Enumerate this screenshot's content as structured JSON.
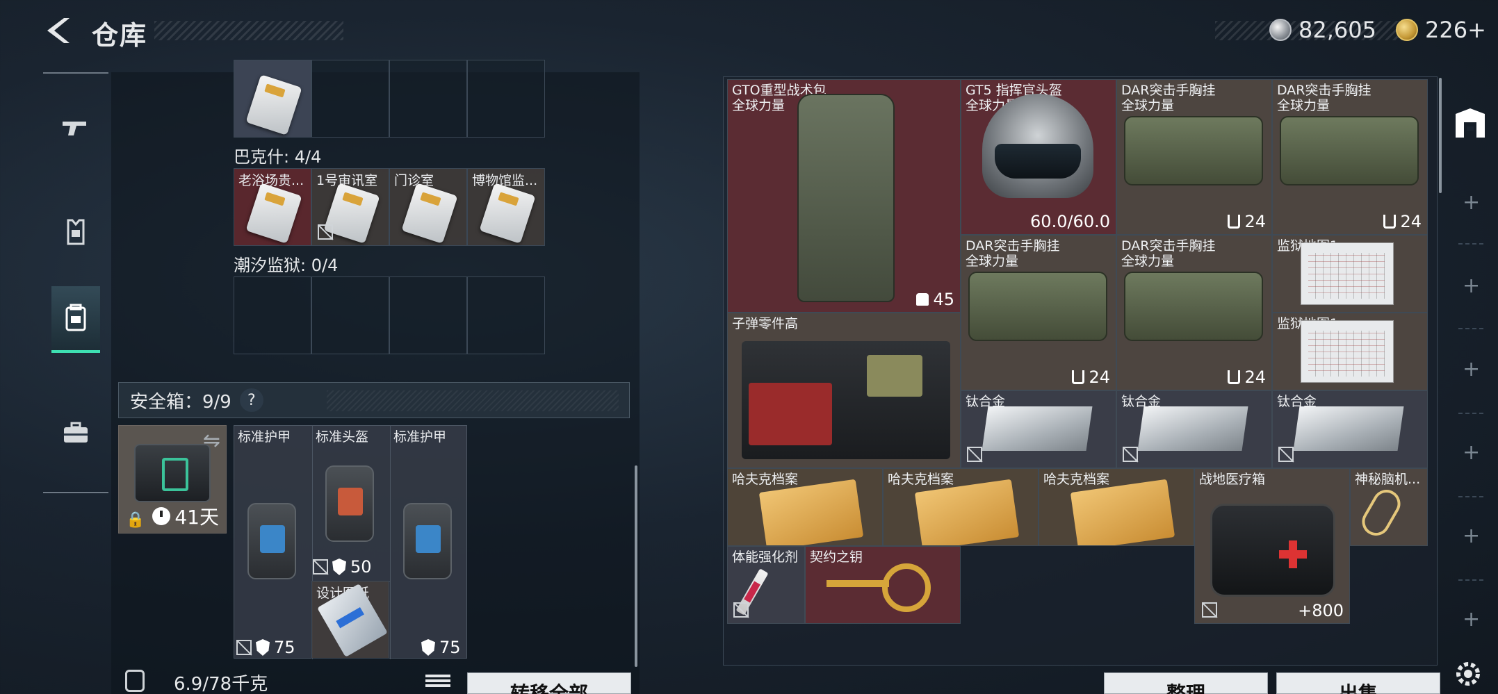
{
  "header": {
    "title": "仓库",
    "currency_silver": "82,605",
    "currency_gold": "226+",
    "colors": {
      "accent": "#3ee0b2"
    }
  },
  "nav": {
    "items": [
      {
        "icon": "gun-icon"
      },
      {
        "icon": "armor-vest-icon"
      },
      {
        "icon": "backpack-icon",
        "active": true
      },
      {
        "icon": "briefcase-icon"
      }
    ]
  },
  "backpack": {
    "section_bakeshi": "巴克什: 4/4",
    "section_chaoxi": "潮汐监狱: 0/4",
    "keys_bakeshi": [
      "老浴场贵...",
      "1号审讯室",
      "门诊室",
      "博物馆监..."
    ],
    "safebox_label": "安全箱：9/9",
    "safebox_help": "?",
    "safebox_days": "41天",
    "armor": [
      {
        "name": "标准护甲",
        "value": "75"
      },
      {
        "name": "标准头盔",
        "value": "50"
      },
      {
        "name": "标准护甲",
        "value": "75"
      }
    ],
    "blueprint_name": "设计图纸",
    "weight": "6.9/78千克",
    "transfer_all": "转移全部"
  },
  "warehouse": {
    "items": [
      {
        "name": "GTO重型战术包",
        "sub": "全球力量",
        "value": "45"
      },
      {
        "name": "GT5 指挥官头盔",
        "sub": "全球力量",
        "value": "60.0/60.0"
      },
      {
        "name": "DAR突击手胸挂",
        "sub": "全球力量",
        "value": "24"
      },
      {
        "name": "DAR突击手胸挂",
        "sub": "全球力量",
        "value": "24"
      },
      {
        "name": "DAR突击手胸挂",
        "sub": "全球力量",
        "value": "24"
      },
      {
        "name": "DAR突击手胸挂",
        "sub": "全球力量",
        "value": "24"
      },
      {
        "name": "监狱地图1"
      },
      {
        "name": "监狱地图1"
      },
      {
        "name": "子弹零件高"
      },
      {
        "name": "钛合金"
      },
      {
        "name": "钛合金"
      },
      {
        "name": "钛合金"
      },
      {
        "name": "哈夫克档案"
      },
      {
        "name": "哈夫克档案"
      },
      {
        "name": "哈夫克档案"
      },
      {
        "name": "战地医疗箱",
        "value": "+800"
      },
      {
        "name": "神秘脑机..."
      },
      {
        "name": "体能强化剂"
      },
      {
        "name": "契约之钥"
      }
    ],
    "sort_label": "整理",
    "sell_label": "出售"
  }
}
